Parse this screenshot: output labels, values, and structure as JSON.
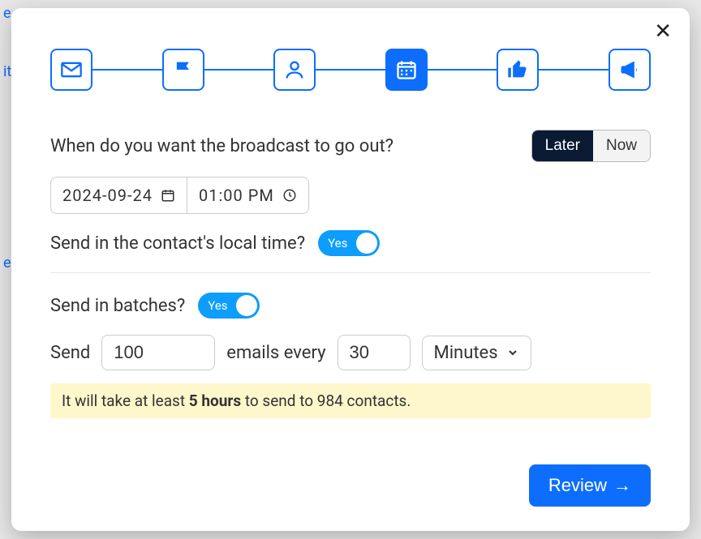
{
  "backdrop": {
    "t1": "e",
    "t2": "it",
    "t3": "e"
  },
  "stepper": {
    "steps": [
      "email",
      "flag",
      "person",
      "calendar",
      "thumbs-up",
      "megaphone"
    ],
    "active_index": 3
  },
  "schedule": {
    "prompt": "When do you want the broadcast to go out?",
    "seg_later": "Later",
    "seg_now": "Now",
    "seg_active": "Later",
    "date": "2024-09-24",
    "time": "01:00 PM"
  },
  "local_time": {
    "label": "Send in the contact's local time?",
    "switch_label": "Yes"
  },
  "batches": {
    "label": "Send in batches?",
    "switch_label": "Yes",
    "row_prefix": "Send",
    "row_mid": "emails every",
    "count": "100",
    "interval": "30",
    "unit": "Minutes"
  },
  "notice": {
    "pre": "It will take at least ",
    "strong": "5 hours",
    "post": " to send to 984 contacts."
  },
  "footer": {
    "review": "Review"
  }
}
